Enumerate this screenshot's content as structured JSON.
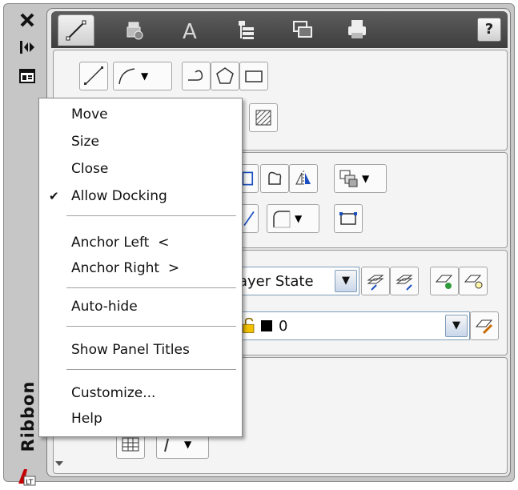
{
  "palette": {
    "title_bar": "#c6c6c6",
    "ribbon_bg": "#e7e7e7",
    "tabstrip": "#4a4a4a",
    "menu_bg": "#ffffff",
    "separator": "#a0a0a0",
    "layer_color_swatch": "#000000"
  },
  "title_bar": {
    "close_icon": "close-icon",
    "anchor_icon": "anchor-toggle-icon",
    "properties_icon": "properties-icon",
    "title": "Ribbon",
    "app_icon": "autocad-lt-icon"
  },
  "ribbon": {
    "tabs": [
      {
        "icon": "draw-tab-icon",
        "active": true
      },
      {
        "icon": "insert-tab-icon"
      },
      {
        "icon": "annotate-tab-icon"
      },
      {
        "icon": "manage-tab-icon"
      },
      {
        "icon": "view-tab-icon"
      },
      {
        "icon": "output-tab-icon"
      }
    ],
    "help_label": "?",
    "layers_panel": {
      "layer_state_value": "ayer State",
      "current_layer_value": "0"
    }
  },
  "context_menu": {
    "items": [
      {
        "label": "Move"
      },
      {
        "label": "Size"
      },
      {
        "label": "Close"
      },
      {
        "label": "Allow Docking",
        "checked": true,
        "check_glyph": "✔"
      },
      {
        "label": "Anchor Left  <"
      },
      {
        "label": "Anchor Right  >"
      },
      {
        "label": "Auto-hide"
      },
      {
        "label": "Show Panel Titles"
      },
      {
        "label": "Customize..."
      },
      {
        "label": "Help"
      }
    ]
  }
}
